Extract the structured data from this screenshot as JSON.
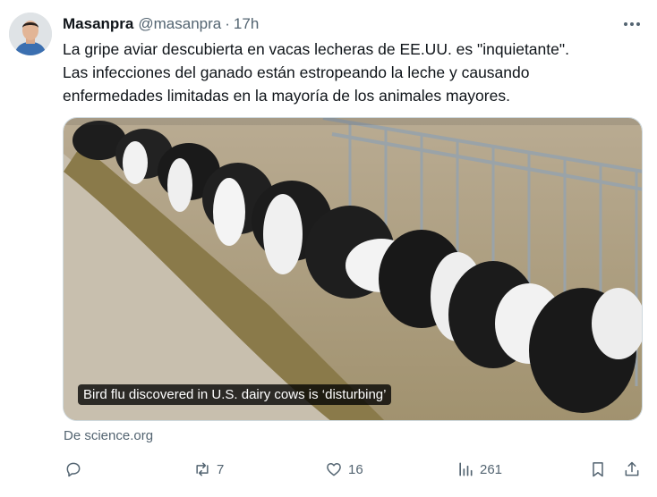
{
  "author": {
    "display_name": "Masanpra",
    "handle": "@masanpra",
    "separator": "·",
    "time": "17h",
    "avatar_icon": "avatar-photo"
  },
  "tweet": {
    "lines": [
      "La gripe aviar descubierta en vacas lecheras de EE.UU. es \"inquietante\".",
      "Las infecciones del ganado están estropeando la leche y causando",
      "enfermedades limitadas en la mayoría de los animales mayores."
    ]
  },
  "card": {
    "caption": "Bird flu discovered in U.S. dairy cows is ‘disturbing’",
    "source": "De science.org"
  },
  "actions": {
    "reply": {
      "icon": "reply-icon",
      "count": ""
    },
    "retweet": {
      "icon": "retweet-icon",
      "count": "7"
    },
    "like": {
      "icon": "heart-icon",
      "count": "16"
    },
    "views": {
      "icon": "views-chart-icon",
      "count": "261"
    },
    "bookmark": {
      "icon": "bookmark-icon"
    },
    "share": {
      "icon": "share-icon"
    }
  },
  "colors": {
    "text": "#0f1419",
    "secondary": "#536471",
    "border": "#cfd9de"
  }
}
